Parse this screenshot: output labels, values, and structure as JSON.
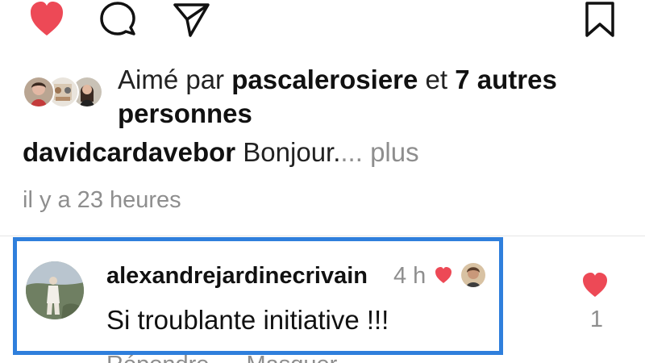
{
  "actions": {
    "like_icon": "heart-filled-icon",
    "comment_icon": "comment-bubble-icon",
    "share_icon": "paper-plane-icon",
    "save_icon": "bookmark-icon"
  },
  "likes": {
    "prefix": "Aimé par ",
    "user": "pascalerosiere",
    "middle": " et ",
    "others": "7 autres personnes"
  },
  "caption": {
    "username": "davidcardavebor",
    "text": " Bonjour.",
    "more": "... plus"
  },
  "post_time": "il y a 23 heures",
  "comment": {
    "username": "alexandrejardinecrivain",
    "time": "4 h",
    "text": "Si troublante initiative !!!",
    "like_count": "1",
    "reply_label": "Répondre",
    "hide_label": "Masquer"
  },
  "colors": {
    "accent_red": "#ed4956",
    "highlight_blue": "#2f7fdc",
    "muted_gray": "#8e8e8e"
  }
}
